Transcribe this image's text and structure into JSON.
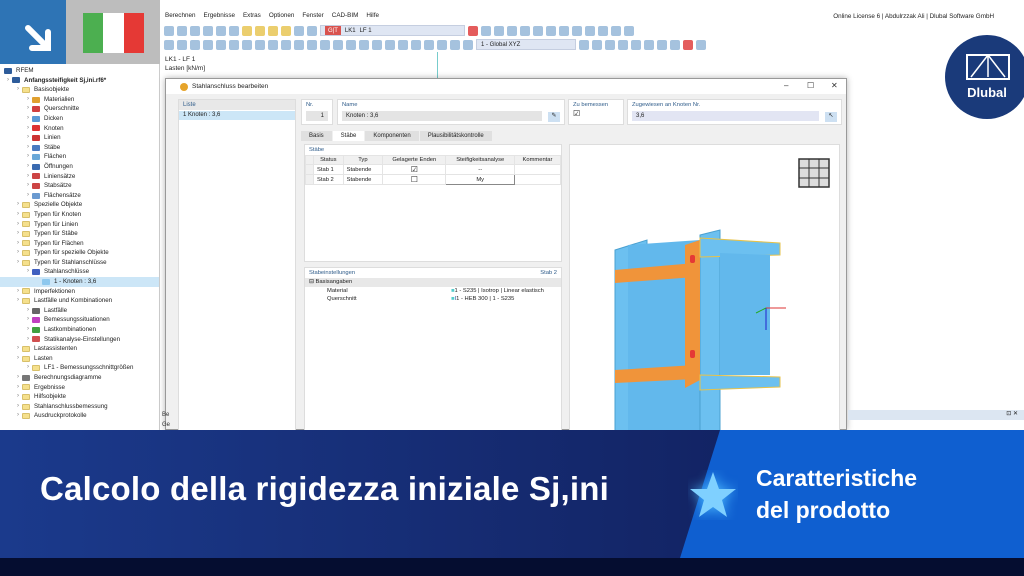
{
  "app": {
    "license": "Online License 6 | Abdulrzzak Ali | Dlubal Software GmbH"
  },
  "menu": [
    "Berechnen",
    "Ergebnisse",
    "Extras",
    "Optionen",
    "Fenster",
    "CAD-BIM",
    "Hilfe"
  ],
  "toolbar": {
    "loadcase_badge": "G|T",
    "loadcase_code": "LK1",
    "loadcase_name": "LF 1",
    "coord_system": "1 - Global XYZ"
  },
  "view_header": {
    "line1": "LK1 - LF 1",
    "line2": "Lasten [kN/m]"
  },
  "tree": {
    "root": "RFEM",
    "items": [
      {
        "label": "Anfangssteifigkeit Sj,ini.rf6*",
        "level": 0,
        "icon": "model"
      },
      {
        "label": "Basisobjekte",
        "level": 1,
        "icon": "folder"
      },
      {
        "label": "Materialien",
        "level": 2,
        "icon": "material"
      },
      {
        "label": "Querschnitte",
        "level": 2,
        "icon": "section"
      },
      {
        "label": "Dicken",
        "level": 2,
        "icon": "thickness"
      },
      {
        "label": "Knoten",
        "level": 2,
        "icon": "node"
      },
      {
        "label": "Linien",
        "level": 2,
        "icon": "line"
      },
      {
        "label": "Stäbe",
        "level": 2,
        "icon": "member"
      },
      {
        "label": "Flächen",
        "level": 2,
        "icon": "surface"
      },
      {
        "label": "Öffnungen",
        "level": 2,
        "icon": "opening"
      },
      {
        "label": "Liniensätze",
        "level": 2,
        "icon": "lineset"
      },
      {
        "label": "Stabsätze",
        "level": 2,
        "icon": "memberset"
      },
      {
        "label": "Flächensätze",
        "level": 2,
        "icon": "surfaceset"
      },
      {
        "label": "Spezielle Objekte",
        "level": 1,
        "icon": "folder"
      },
      {
        "label": "Typen für Knoten",
        "level": 1,
        "icon": "folder"
      },
      {
        "label": "Typen für Linien",
        "level": 1,
        "icon": "folder"
      },
      {
        "label": "Typen für Stäbe",
        "level": 1,
        "icon": "folder"
      },
      {
        "label": "Typen für Flächen",
        "level": 1,
        "icon": "folder"
      },
      {
        "label": "Typen für spezielle Objekte",
        "level": 1,
        "icon": "folder"
      },
      {
        "label": "Typen für Stahlanschlüsse",
        "level": 1,
        "icon": "folder"
      },
      {
        "label": "Stahlanschlüsse",
        "level": 2,
        "icon": "connection"
      },
      {
        "label": "1 - Knoten : 3,6",
        "level": 3,
        "icon": "item",
        "selected": true
      },
      {
        "label": "Imperfektionen",
        "level": 1,
        "icon": "folder"
      },
      {
        "label": "Lastfälle und Kombinationen",
        "level": 1,
        "icon": "folder"
      },
      {
        "label": "Lastfälle",
        "level": 2,
        "icon": "loadcase"
      },
      {
        "label": "Bemessungssituationen",
        "level": 2,
        "icon": "designsit"
      },
      {
        "label": "Lastkombinationen",
        "level": 2,
        "icon": "loadcombo"
      },
      {
        "label": "Statikanalyse-Einstellungen",
        "level": 2,
        "icon": "analysis"
      },
      {
        "label": "Lastassistenten",
        "level": 1,
        "icon": "folder"
      },
      {
        "label": "Lasten",
        "level": 1,
        "icon": "folder"
      },
      {
        "label": "LF1 - Bemessungsschnittgrößen",
        "level": 2,
        "icon": "folder"
      },
      {
        "label": "Berechnungsdiagramme",
        "level": 1,
        "icon": "diagram"
      },
      {
        "label": "Ergebnisse",
        "level": 1,
        "icon": "folder"
      },
      {
        "label": "Hilfsobjekte",
        "level": 1,
        "icon": "folder"
      },
      {
        "label": "Stahlanschlussbemessung",
        "level": 1,
        "icon": "folder"
      },
      {
        "label": "Ausdruckprotokolle",
        "level": 1,
        "icon": "folder"
      }
    ]
  },
  "dialog": {
    "title": "Stahlanschluss bearbeiten",
    "list_header": "Liste",
    "list_items": [
      "1  Knoten : 3,6"
    ],
    "no_label": "Nr.",
    "no_value": "1",
    "name_label": "Name",
    "name_value": "Knoten : 3,6",
    "design_label": "Zu bemessen",
    "assigned_label": "Zugewiesen an Knoten Nr.",
    "assigned_value": "3,6",
    "tabs": [
      "Basis",
      "Stäbe",
      "Komponenten",
      "Plausibilitätskontrolle"
    ],
    "active_tab": "Stäbe",
    "members_title": "Stäbe",
    "columns": [
      "Status",
      "Typ",
      "Gelagerte Enden",
      "Steifigkeitsanalyse",
      "Kommentar"
    ],
    "rows": [
      {
        "status": "Stab 1",
        "typ": "Stabende",
        "supported": true,
        "stiffness": "--",
        "comment": ""
      },
      {
        "status": "Stab 2",
        "typ": "Stabende",
        "supported": false,
        "stiffness": "My",
        "comment": ""
      }
    ],
    "settings_title": "Stabeinstellungen",
    "settings_member": "Stab 2",
    "settings_group": "Basisangaben",
    "settings": [
      {
        "label": "Material",
        "value": "1 - S235 | Isotrop | Linear elastisch"
      },
      {
        "label": "Querschnitt",
        "value": "1 - HEB 300 | 1 - S235"
      }
    ]
  },
  "side_panel": {
    "title": "Be",
    "sub": "Ge"
  },
  "logo": "Dlubal",
  "banner": {
    "title": "Calcolo della rigidezza iniziale Sj,ini",
    "subtitle_line1": "Caratteristiche",
    "subtitle_line2": "del prodotto"
  },
  "colors": {
    "accent": "#0f5fd0",
    "navy": "#14276a",
    "flag_green": "#4caf50",
    "flag_red": "#e53935"
  }
}
